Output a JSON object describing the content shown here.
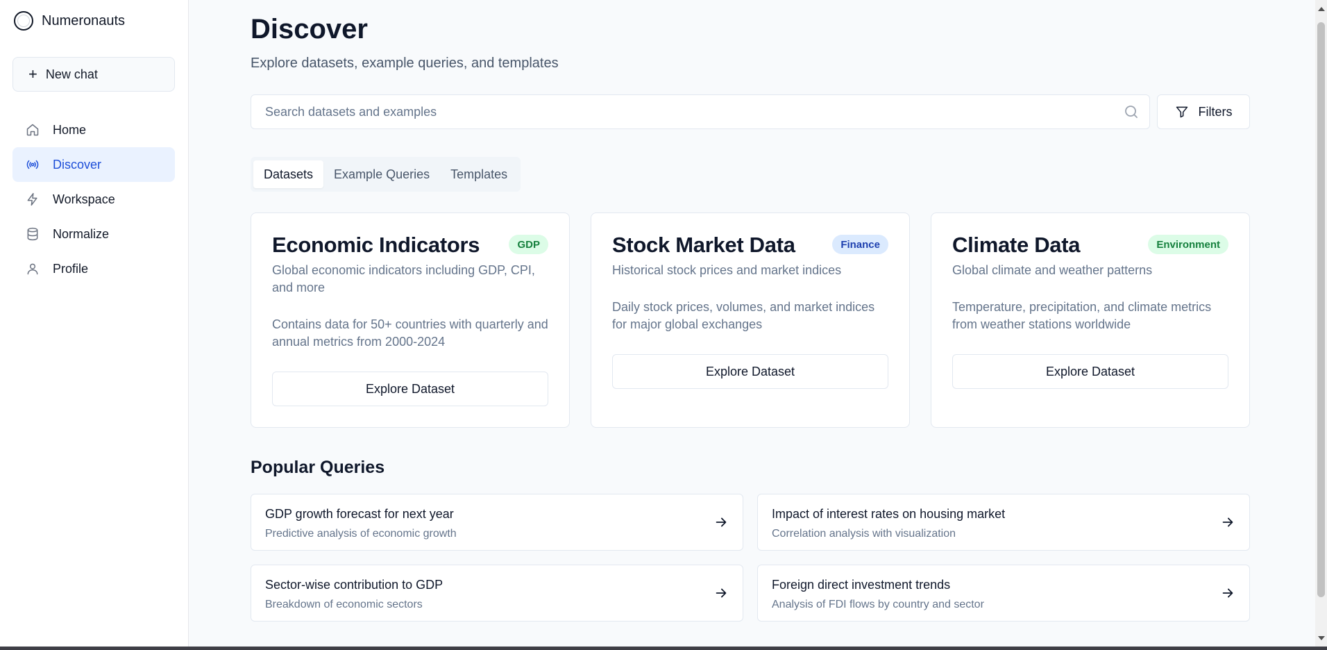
{
  "app": {
    "name": "Numeronauts"
  },
  "sidebar": {
    "new_chat": "New chat",
    "items": [
      {
        "label": "Home",
        "icon": "home-icon"
      },
      {
        "label": "Discover",
        "icon": "broadcast-icon",
        "active": true
      },
      {
        "label": "Workspace",
        "icon": "lightning-icon"
      },
      {
        "label": "Normalize",
        "icon": "database-icon"
      },
      {
        "label": "Profile",
        "icon": "user-icon"
      }
    ]
  },
  "header": {
    "title": "Discover",
    "subtitle": "Explore datasets, example queries, and templates"
  },
  "search": {
    "placeholder": "Search datasets and examples",
    "value": ""
  },
  "filters_label": "Filters",
  "tabs": [
    {
      "label": "Datasets",
      "active": true
    },
    {
      "label": "Example Queries"
    },
    {
      "label": "Templates"
    }
  ],
  "datasets": [
    {
      "title": "Economic Indicators",
      "badge": "GDP",
      "badge_color": "#15803d",
      "description": "Global economic indicators including GDP, CPI, and more",
      "details": "Contains data for 50+ countries with quarterly and annual metrics from 2000-2024",
      "button": "Explore Dataset"
    },
    {
      "title": "Stock Market Data",
      "badge": "Finance",
      "badge_color": "#1e40af",
      "description": "Historical stock prices and market indices",
      "details": "Daily stock prices, volumes, and market indices for major global exchanges",
      "button": "Explore Dataset"
    },
    {
      "title": "Climate Data",
      "badge": "Environment",
      "badge_color": "#15803d",
      "description": "Global climate and weather patterns",
      "details": "Temperature, precipitation, and climate metrics from weather stations worldwide",
      "button": "Explore Dataset"
    }
  ],
  "popular": {
    "title": "Popular Queries",
    "queries": [
      {
        "title": "GDP growth forecast for next year",
        "subtitle": "Predictive analysis of economic growth"
      },
      {
        "title": "Impact of interest rates on housing market",
        "subtitle": "Correlation analysis with visualization"
      },
      {
        "title": "Sector-wise contribution to GDP",
        "subtitle": "Breakdown of economic sectors"
      },
      {
        "title": "Foreign direct investment trends",
        "subtitle": "Analysis of FDI flows by country and sector"
      }
    ]
  },
  "colors": {
    "accent": "#1d4ed8",
    "active_bg": "#eaf2ff",
    "page_bg": "#f8fafc"
  }
}
